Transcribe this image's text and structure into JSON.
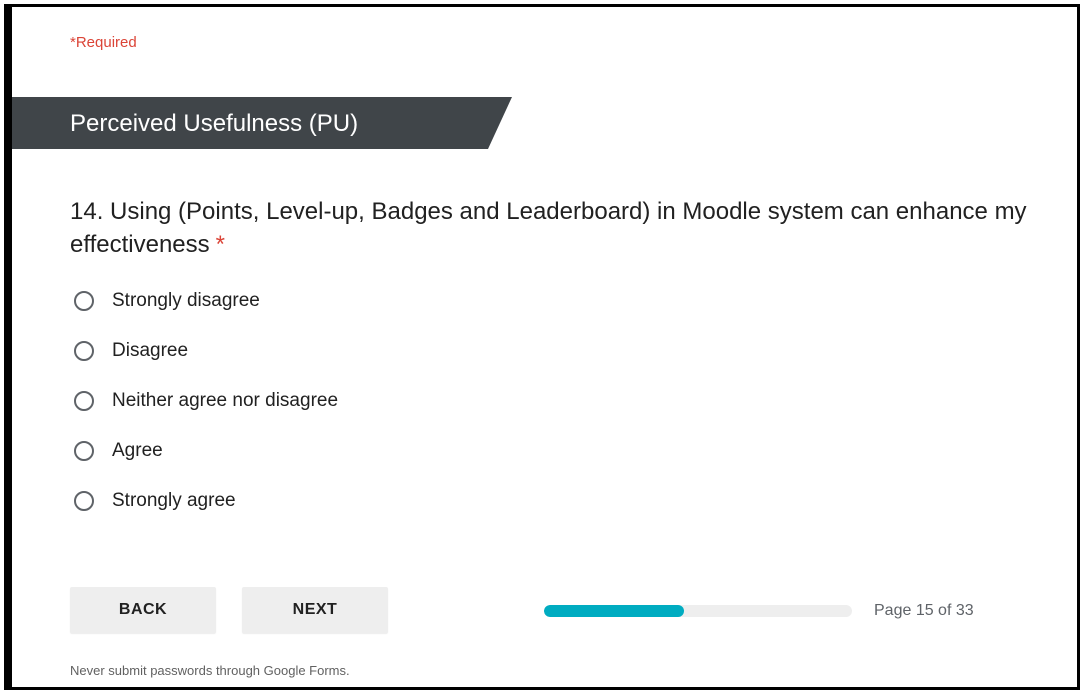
{
  "form": {
    "required_note": "*Required",
    "section_title": "Perceived Usefulness (PU)",
    "question": {
      "text": "14. Using (Points, Level-up, Badges and Leaderboard) in Moodle system can enhance my effectiveness",
      "required_mark": "*",
      "options": [
        {
          "label": "Strongly disagree",
          "selected": false
        },
        {
          "label": "Disagree",
          "selected": false
        },
        {
          "label": "Neither agree nor disagree",
          "selected": false
        },
        {
          "label": "Agree",
          "selected": false
        },
        {
          "label": "Strongly agree",
          "selected": false
        }
      ]
    },
    "navigation": {
      "back_label": "BACK",
      "next_label": "NEXT"
    },
    "progress": {
      "fraction": 0.4545,
      "page_label": "Page 15 of 33"
    },
    "footer_note": "Never submit passwords through Google Forms."
  },
  "colors": {
    "required": "#db4437",
    "section_banner": "#404549",
    "progress_fill": "#00acc1",
    "progress_track": "#eeeeee",
    "button_bg": "#eeeeee"
  }
}
